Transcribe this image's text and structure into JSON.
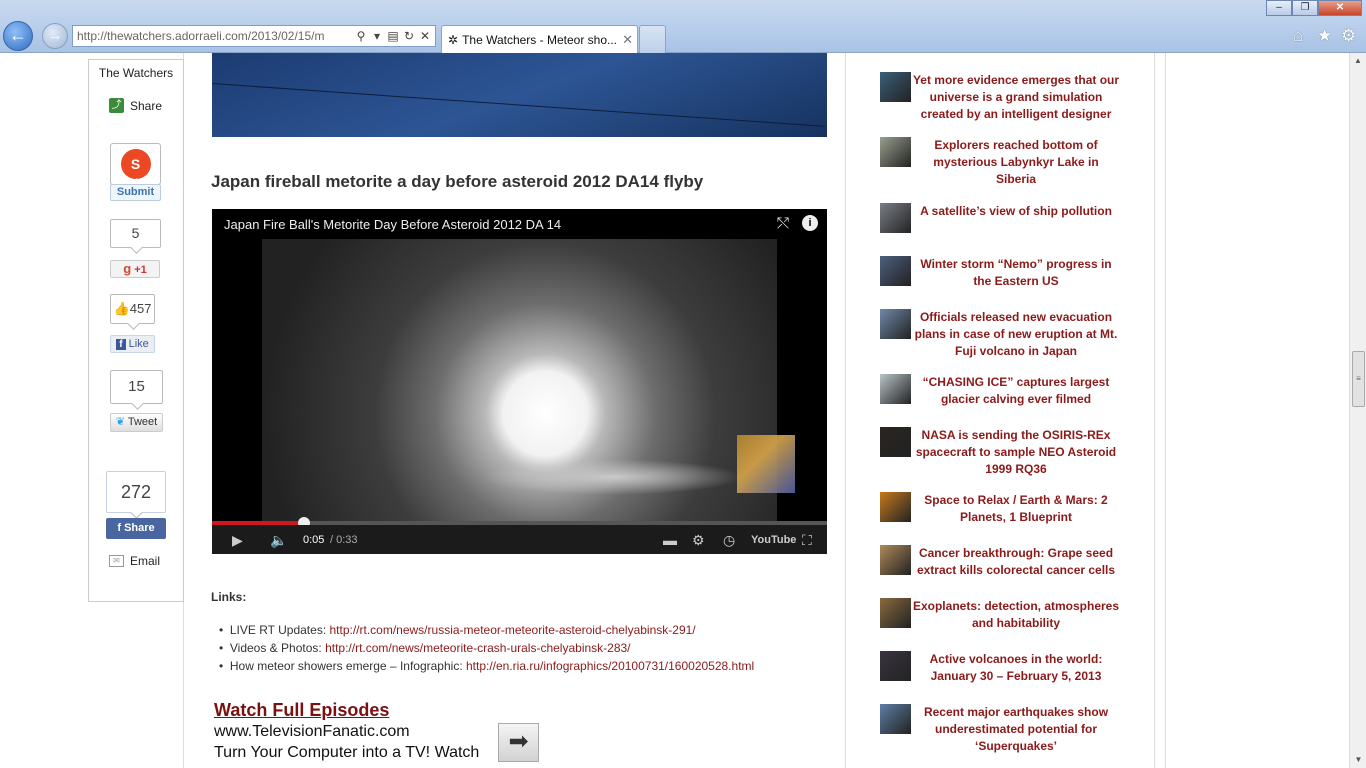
{
  "browser": {
    "url": "http://thewatchers.adorraeli.com/2013/02/15/m",
    "tab_title": "The Watchers - Meteor sho...",
    "window_buttons": [
      "–",
      "❐",
      "✕"
    ]
  },
  "share_bar": {
    "brand": "The Watchers",
    "share_label": "Share",
    "stumble_label": "Submit",
    "gplus_count": "5",
    "gplus_label": "+1",
    "fb_like_count": "457",
    "fb_like_label": "Like",
    "tweet_count": "15",
    "tweet_label": "Tweet",
    "fb_share_count": "272",
    "fb_share_label": "Share",
    "email_label": "Email"
  },
  "article": {
    "title": "Japan fireball metorite a day before asteroid 2012 DA14 flyby",
    "video": {
      "title": "Japan Fire Ball's Metorite Day Before Asteroid 2012 DA 14",
      "current_time": "0:05",
      "duration": "/ 0:33",
      "progress_fraction": 0.15
    },
    "links_label": "Links:",
    "links": [
      {
        "label": "LIVE RT Updates: ",
        "url": "http://rt.com/news/russia-meteor-meteorite-asteroid-chelyabinsk-291/"
      },
      {
        "label": "Videos & Photos: ",
        "url": "http://rt.com/news/meteorite-crash-urals-chelyabinsk-283/"
      },
      {
        "label": "How meteor showers emerge – Infographic: ",
        "url": "http://en.ria.ru/infographics/20100731/160020528.html"
      }
    ],
    "ad": {
      "title": "Watch Full Episodes",
      "line1": "www.TelevisionFanatic.com",
      "line2": "Turn Your Computer into a TV! Watch"
    }
  },
  "sidebar": {
    "articles": [
      {
        "title": "Yet more evidence emerges that our universe is a grand simulation created by an intelligent designer",
        "color": "#3a5f7a"
      },
      {
        "title": "Explorers reached bottom of mysterious Labynkyr Lake in Siberia",
        "color": "#9aa08f"
      },
      {
        "title": "A satellite’s view of ship pollution",
        "color": "#7a7f86"
      },
      {
        "title": "Winter storm “Nemo” progress in the Eastern US",
        "color": "#4d5f7f"
      },
      {
        "title": "Officials released new evacuation plans in case of new eruption at Mt. Fuji volcano in Japan",
        "color": "#6f88a8"
      },
      {
        "title": "“CHASING ICE” captures largest glacier calving ever filmed",
        "color": "#b7c4c8"
      },
      {
        "title": "NASA is sending the OSIRIS-REx spacecraft to sample NEO Asteroid 1999 RQ36",
        "color": "#2a2520"
      },
      {
        "title": "Space to Relax / Earth & Mars: 2 Planets, 1 Blueprint",
        "color": "#c57a1d"
      },
      {
        "title": "Cancer breakthrough: Grape seed extract kills colorectal cancer cells",
        "color": "#b08a5a"
      },
      {
        "title": "Exoplanets: detection, atmospheres and habitability",
        "color": "#8a6a3f"
      },
      {
        "title": "Active volcanoes in the world: January 30 – February 5, 2013",
        "color": "#3a3440"
      },
      {
        "title": "Recent major earthquakes show underestimated potential for ‘Superquakes’",
        "color": "#5c7fa6"
      }
    ]
  }
}
